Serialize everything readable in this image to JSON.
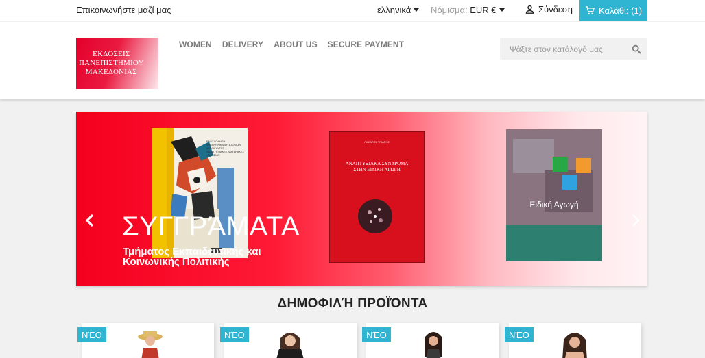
{
  "topbar": {
    "contact": "Επικοινωνήστε μαζί μας",
    "language": "ελληνικά",
    "currency_label": "Νόμισμα:",
    "currency_value": "EUR €",
    "signin": "Σύνδεση",
    "cart": "Καλάθι: (1)"
  },
  "header": {
    "logo_lines": [
      "ΕΚΔΟΣΕΙΣ",
      "ΠΑΝΕΠΙΣΤΗΜΙΟΥ",
      "ΜΑΚΕΔΟΝΙΑΣ"
    ],
    "nav": [
      "WOMEN",
      "DELIVERY",
      "ABOUT US",
      "SECURE PAYMENT"
    ],
    "search_placeholder": "Ψάξτε στον κατάλογό μας"
  },
  "carousel": {
    "title": "ΣΥΓΓΡΆΜΑΤΑ",
    "subtitle": "Τμήματος Εκπαιδευτικής και Κοινωνικής Πολιτικής",
    "books": [
      {
        "title_lines": [
          "ΕΝΑΣΧΟΛΗΣΗ",
          "ΚΑΙ ΕΝΗΛΙΚΙΩΣΗ ΑΤΟΜΩΝ",
          "ΜΕ ΔΙΑΧΥΤΕΣ",
          "ΑΝΑΠΤΥΞΙΑΚΕΣ ΔΙΑΤΑΡΑΧΕΣ",
          "/ ΑΥΤΙΣΜΟ"
        ]
      },
      {
        "author": "ΛΑΖΑΡΟΣ ΤΡΙΑΡΗΣ",
        "title_lines": [
          "ΑΝΑΠΤΥΞΙΑΚΑ ΣΥΝΔΡΟΜΑ",
          "ΣΤΗΝ ΕΙΔΙΚΗ ΑΓΩΓΗ"
        ]
      },
      {
        "title": "Ειδική Αγωγή"
      }
    ]
  },
  "popular": {
    "title": "ΔΗΜΟΦΙΛΉ ΠΡΟΪΌΝΤΑ",
    "badges": [
      "ΝΈΟ",
      "ΝΈΟ",
      "ΝΈΟ",
      "ΝΈΟ"
    ]
  },
  "colors": {
    "accent": "#2fb5d2",
    "brand_red": "#e4002b"
  },
  "icons": {
    "signin": "person-icon",
    "cart": "cart-icon",
    "search": "search-icon",
    "prev": "chevron-left-icon",
    "next": "chevron-right-icon"
  }
}
